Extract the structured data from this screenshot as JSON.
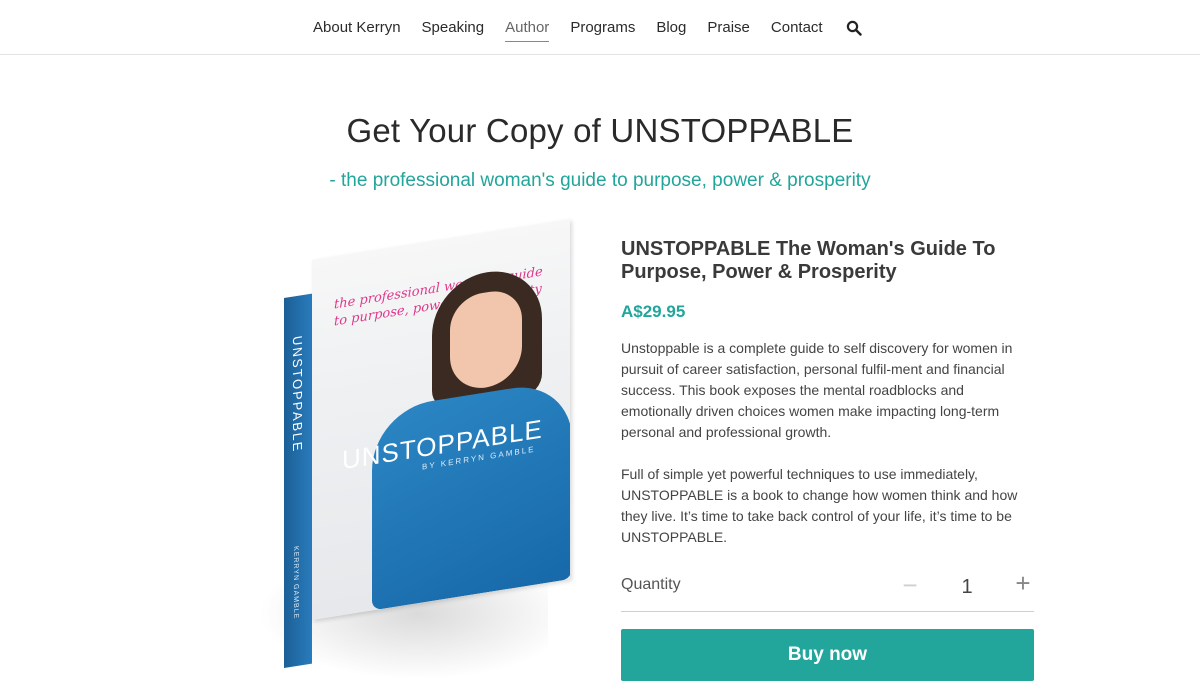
{
  "nav": {
    "items": [
      {
        "label": "About Kerryn",
        "active": false
      },
      {
        "label": "Speaking",
        "active": false
      },
      {
        "label": "Author",
        "active": true
      },
      {
        "label": "Programs",
        "active": false
      },
      {
        "label": "Blog",
        "active": false
      },
      {
        "label": "Praise",
        "active": false
      },
      {
        "label": "Contact",
        "active": false
      }
    ],
    "search_icon": "search-icon"
  },
  "header": {
    "title": "Get Your Copy of UNSTOPPABLE",
    "subtitle": "- the professional woman's guide to purpose, power & prosperity"
  },
  "book_cover": {
    "tagline": "the professional woman's guide to purpose, power & prosperity",
    "title": "UNSTOPPABLE",
    "byline": "BY KERRYN GAMBLE",
    "spine_title": "UNSTOPPABLE",
    "spine_author": "KERRYN GAMBLE"
  },
  "product": {
    "title": "UNSTOPPABLE The Woman's Guide To Purpose, Power & Prosperity",
    "price": "A$29.95",
    "description": [
      "Unstoppable is a complete guide to self discovery for women in pursuit of career satisfaction, personal fulfil-ment and financial success. This book exposes the mental roadblocks and emotionally driven choices women make impacting long-term personal and professional growth.",
      "Full of simple yet powerful techniques to use immediately, UNSTOPPABLE is a book to change how women think and how they live. It’s time to take back control of your life, it’s time to be UNSTOPPABLE."
    ],
    "quantity_label": "Quantity",
    "quantity_value": "1",
    "minus_symbol": "−",
    "plus_symbol": "+",
    "buy_label": "Buy now"
  },
  "colors": {
    "accent": "#22a59a",
    "cover_blue": "#1f74b5",
    "tagline_pink": "#e0378a"
  }
}
